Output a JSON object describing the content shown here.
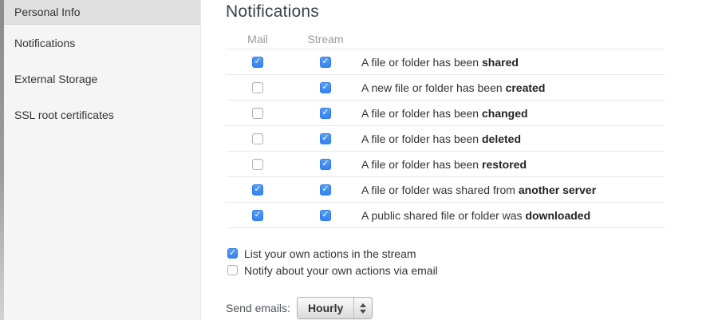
{
  "sidebar": {
    "items": [
      {
        "label": "Personal Info",
        "selected": true
      },
      {
        "label": "Notifications",
        "selected": false
      },
      {
        "label": "External Storage",
        "selected": false
      },
      {
        "label": "SSL root certificates",
        "selected": false
      }
    ]
  },
  "main": {
    "title": "Notifications",
    "table": {
      "columns": [
        "Mail",
        "Stream"
      ],
      "rows": [
        {
          "mail": true,
          "stream": true,
          "text": "A file or folder has been ",
          "bold": "shared"
        },
        {
          "mail": false,
          "stream": true,
          "text": "A new file or folder has been ",
          "bold": "created"
        },
        {
          "mail": false,
          "stream": true,
          "text": "A file or folder has been ",
          "bold": "changed"
        },
        {
          "mail": false,
          "stream": true,
          "text": "A file or folder has been ",
          "bold": "deleted"
        },
        {
          "mail": false,
          "stream": true,
          "text": "A file or folder has been ",
          "bold": "restored"
        },
        {
          "mail": true,
          "stream": true,
          "text": "A file or folder was shared from ",
          "bold": "another server"
        },
        {
          "mail": true,
          "stream": true,
          "text": "A public shared file or folder was ",
          "bold": "downloaded"
        }
      ]
    },
    "options": [
      {
        "label": "List your own actions in the stream",
        "checked": true
      },
      {
        "label": "Notify about your own actions via email",
        "checked": false
      }
    ],
    "send_emails": {
      "label": "Send emails:",
      "value": "Hourly"
    }
  },
  "colors": {
    "checkbox_accent": "#4690f0",
    "sidebar_bg": "#f5f5f5",
    "sidebar_selected_bg": "#e0e0e0",
    "row_separator": "#e9e9e9"
  }
}
